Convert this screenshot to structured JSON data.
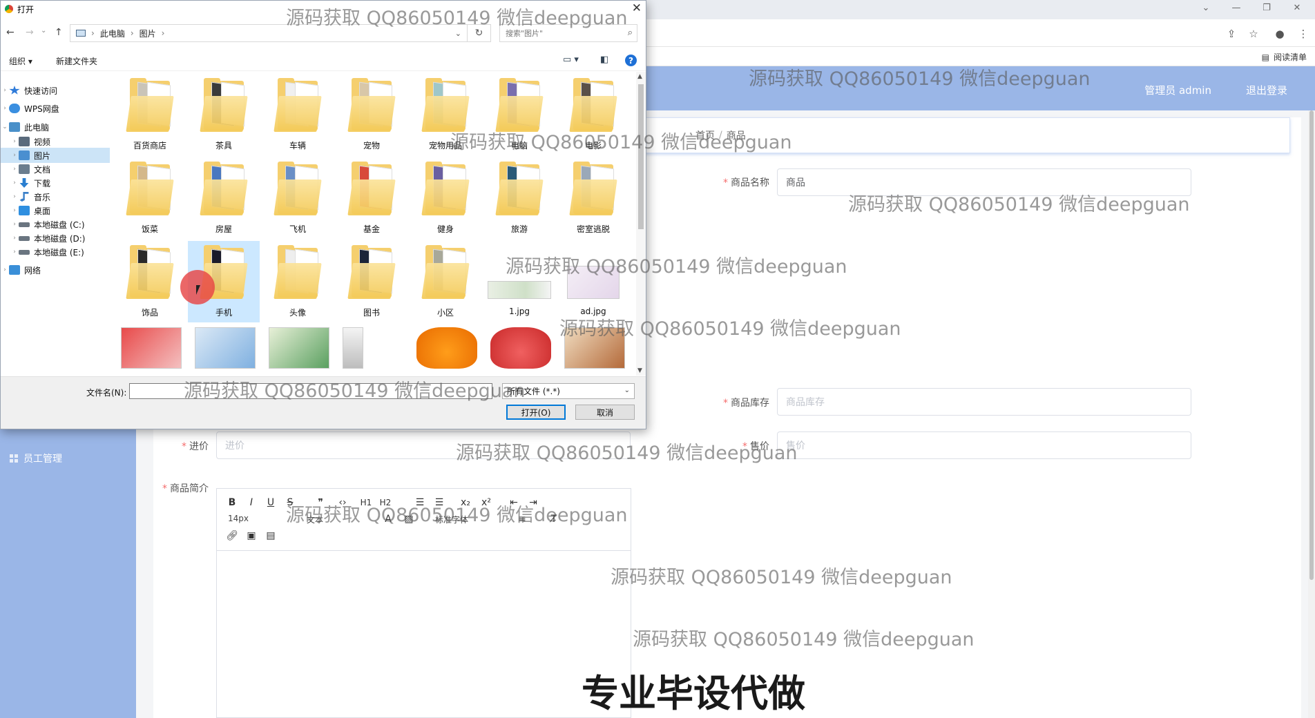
{
  "browser": {
    "reading_list": "阅读清单"
  },
  "app": {
    "user": "管理员 admin",
    "logout": "退出登录",
    "sidebar_item": "员工管理"
  },
  "breadcrumb": {
    "home": "首页",
    "current": "商品"
  },
  "form": {
    "name_label": "商品名称",
    "name_value": "商品",
    "stock_label": "商品库存",
    "stock_placeholder": "商品库存",
    "cost_label": "进价",
    "cost_placeholder": "进价",
    "price_label": "售价",
    "price_placeholder": "售价",
    "desc_label": "商品简介"
  },
  "editor": {
    "font_size": "14px",
    "font_text": "文本",
    "font_family": "标准字体"
  },
  "dialog": {
    "title": "打开",
    "path": [
      "此电脑",
      "图片"
    ],
    "search_placeholder": "搜索\"图片\"",
    "organize": "组织 ▾",
    "new_folder": "新建文件夹",
    "nav": [
      {
        "label": "快速访问",
        "color": "#2f7bd9"
      },
      {
        "label": "WPS网盘",
        "color": "#3a8fe0"
      },
      {
        "label": "此电脑",
        "color": "#4a90c9"
      },
      {
        "label": "视频",
        "color": "#5a6b7c"
      },
      {
        "label": "图片",
        "color": "#4a8fd0"
      },
      {
        "label": "文档",
        "color": "#6b7d8e"
      },
      {
        "label": "下载",
        "color": "#2a7fd0"
      },
      {
        "label": "音乐",
        "color": "#3a7fc8"
      },
      {
        "label": "桌面",
        "color": "#2f8fe0"
      },
      {
        "label": "本地磁盘 (C:)",
        "color": "#6a7580"
      },
      {
        "label": "本地磁盘 (D:)",
        "color": "#6a7580"
      },
      {
        "label": "本地磁盘 (E:)",
        "color": "#6a7580"
      },
      {
        "label": "网络",
        "color": "#3a8fd8"
      }
    ],
    "folders": [
      "百货商店",
      "茶具",
      "车辆",
      "宠物",
      "宠物用品",
      "电脑",
      "电影",
      "饭菜",
      "房屋",
      "飞机",
      "基金",
      "健身",
      "旅游",
      "密室逃脱",
      "饰品",
      "手机",
      "头像",
      "图书",
      "小区"
    ],
    "images": [
      "1.jpg",
      "ad.jpg"
    ],
    "filename_label": "文件名(N):",
    "filetype": "所有文件 (*.*)",
    "open_button": "打开(O)",
    "cancel_button": "取消"
  },
  "watermark": "源码获取 QQ86050149 微信deepguan",
  "banner": "专业毕设代做"
}
